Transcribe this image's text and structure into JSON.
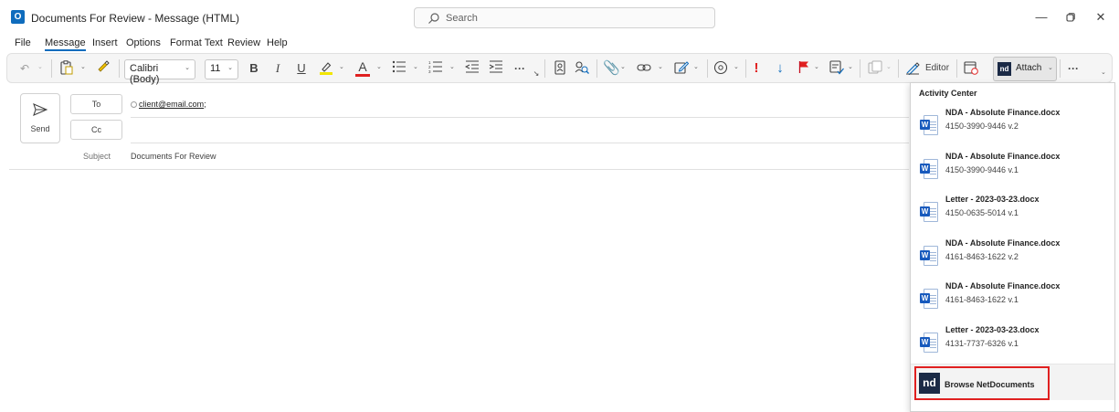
{
  "window": {
    "title": "Documents For Review  -  Message (HTML)",
    "app_icon": "outlook-icon",
    "search_placeholder": "Search",
    "controls": [
      "minimize-icon",
      "restore-icon",
      "close-icon"
    ]
  },
  "menu": {
    "items": [
      "File",
      "Message",
      "Insert",
      "Options",
      "Format Text",
      "Review",
      "Help"
    ],
    "active": "Message"
  },
  "ribbon": {
    "font_name": "Calibri (Body)",
    "font_size": "11",
    "bold": "B",
    "italic": "I",
    "underline": "U",
    "font_color_letter": "A",
    "importance_high": "!",
    "editor_label": "Editor",
    "attach_label": "Attach",
    "more": "···",
    "accent_red": "#e02020",
    "accent_blue": "#0f6cbd"
  },
  "compose": {
    "send_label": "Send",
    "to_label": "To",
    "cc_label": "Cc",
    "recipient": "client@email.com",
    "recipient_suffix": ";",
    "subject_label": "Subject",
    "subject_value": "Documents For Review"
  },
  "activity_center": {
    "title": "Activity Center",
    "documents": [
      {
        "name": "NDA - Absolute Finance.docx",
        "meta": "4150-3990-9446 v.2"
      },
      {
        "name": "NDA - Absolute Finance.docx",
        "meta": "4150-3990-9446 v.1"
      },
      {
        "name": "Letter - 2023-03-23.docx",
        "meta": "4150-0635-5014 v.1"
      },
      {
        "name": "NDA - Absolute Finance.docx",
        "meta": "4161-8463-1622 v.2"
      },
      {
        "name": "NDA - Absolute Finance.docx",
        "meta": "4161-8463-1622 v.1"
      },
      {
        "name": "Letter - 2023-03-23.docx",
        "meta": "4131-7737-6326 v.1"
      }
    ],
    "browse_label": "Browse NetDocuments",
    "nd_logo_text": "nd",
    "word_badge": "W"
  }
}
